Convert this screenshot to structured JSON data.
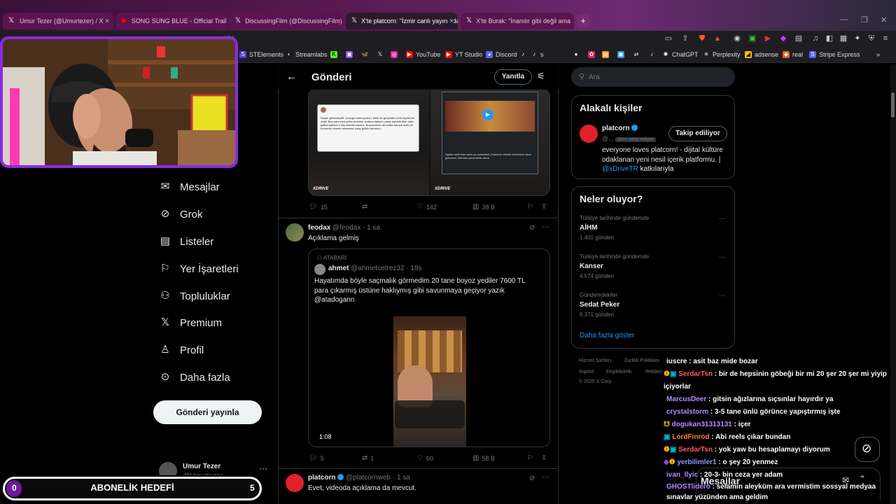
{
  "tabs": [
    {
      "icon": "x-logo",
      "label": "Umur Tezer (@Umurtezer) / X"
    },
    {
      "icon": "youtube-logo",
      "label": "SONG SUNG BLUE - Official Trailer 2"
    },
    {
      "icon": "x-logo",
      "label": "DiscussingFilm (@DiscussingFilm) / X"
    },
    {
      "icon": "x-logo",
      "label": "X'te platcorn: \"İzmir canlı yayınında"
    },
    {
      "icon": "x-logo",
      "label": "X'te Burak: \"İnanılır gibi değil ama"
    }
  ],
  "address_fragment": "954",
  "bookmarks": [
    "STElements",
    "Streamlabs",
    "YouTube",
    "YT Studio",
    "Discord",
    "s",
    "ChatGPT",
    "Perplexity",
    "adsense",
    "real",
    "Stripe Express"
  ],
  "sidebar": {
    "items": [
      {
        "label": "Mesajlar",
        "icon": "mail-icon"
      },
      {
        "label": "Grok",
        "icon": "grok-icon"
      },
      {
        "label": "Listeler",
        "icon": "list-icon"
      },
      {
        "label": "Yer İşaretleri",
        "icon": "bookmark-icon"
      },
      {
        "label": "Topluluklar",
        "icon": "communities-icon"
      },
      {
        "label": "Premium",
        "icon": "x-logo-icon"
      },
      {
        "label": "Profil",
        "icon": "profile-icon"
      },
      {
        "label": "Daha fazla",
        "icon": "more-circle-icon"
      }
    ],
    "post_button": "Gönderi yayınla",
    "user_name": "Umur Tezer",
    "user_handle": "@Umurtezer"
  },
  "sub_goal": {
    "left": "0",
    "label": "ABONELİK HEDEFİ",
    "right": "5",
    "progress": 0
  },
  "header": {
    "title": "Gönderi",
    "reply_button": "Yanıtla"
  },
  "top_tweet": {
    "img1_text": "Keşke gitmeseydik. Çocuğu tanımıyorum, belki de gerçekten kötü niyetli biri değil. Ben yanımıza gelen herkese sordum isteyen varsa yiyebilir diye ama galiba sadece 1 kişi istemiş boyoza. Boyozcunun da kafası karışık belki de. Kimsenin ekmek teknesine zarar gelsin istemem.",
    "img2_text": "Agalar ekliir edin salın şu mutabbeli. Kimsenin ekmek teknesine zarar gelmesin. Benden yana hellal olsun",
    "replies": "15",
    "likes": "142",
    "views": "38 B"
  },
  "tweet2": {
    "name": "feodax",
    "handle": "@feodax",
    "time": "1 sa",
    "text": "Açıklama gelmiş",
    "quote": {
      "context": "ATABARI",
      "name": "ahmet",
      "handle": "@ahmetcetrez32",
      "time": "18s",
      "text": "Hayatımda böyle saçmalık görmedim 20 tane boyoz yediler 7600 TL para çıkarmış üstüne haklıymış gibi savunmaya geçiyor yazık @atadogann",
      "video_duration": "1:08"
    },
    "replies": "5",
    "retweets": "1",
    "likes": "60",
    "views": "58 B"
  },
  "tweet3": {
    "name": "platcorn",
    "handle": "@platcornweb",
    "time": "1 sa",
    "text": "Evet, videoda açıklama da mevcut."
  },
  "right": {
    "search_placeholder": "Ara",
    "related_title": "Alakalı kişiler",
    "related": {
      "name": "platcorn",
      "handle": "@...",
      "follows_you": "Seni takip ediyor",
      "follow_button": "Takip ediliyor",
      "bio_1": "everyone loves platcorn! - dijital kültüre odaklanan yeni nesil içerik platformu. |",
      "bio_link": "@xDriveTR",
      "bio_2": "katkılarıyla"
    },
    "trends_title": "Neler oluyor?",
    "trends": [
      {
        "meta": "Türkiye tarihinde gündemde",
        "name": "AİHM",
        "count": "1.401 gönderi"
      },
      {
        "meta": "Türkiye tarihinde gündemde",
        "name": "Kanser",
        "count": "4.574 gönderi"
      },
      {
        "meta": "Gündemdekiler",
        "name": "Sedat Peker",
        "count": "6.371 gönderi"
      }
    ],
    "show_more": "Daha fazla göster",
    "footer": [
      "Hizmet Şartları",
      "Gizlilik Politikası",
      "Imprint",
      "Erişilebilirlik",
      "Reklam",
      "© 2025 X Corp."
    ]
  },
  "chat": [
    {
      "user": "iuscre",
      "color": "#ffffff",
      "msg": ": asit baz mide bozar",
      "badges": ""
    },
    {
      "user": "SerdarTsn",
      "color": "#ff5a5a",
      "msg": ": bir de hepsinin göbeği bir mi 20 şer 20 şer mi yiyip içiyorlar",
      "badges": "1"
    },
    {
      "user": "MarcusDeer",
      "color": "#b28cff",
      "msg": ": gitsin ağızlarına sıçsınlar hayırdır ya",
      "badges": ""
    },
    {
      "user": "crystalstorm",
      "color": "#b28cff",
      "msg": ": 3-5 tane ünlü görünce yapıştırmış işte",
      "badges": ""
    },
    {
      "user": "dogukan31313131",
      "color": "#b28cff",
      "msg": ": içer",
      "badges": "w"
    },
    {
      "user": "LordFinrod",
      "color": "#ff7a3a",
      "msg": ": Abi reels çıkar bundan",
      "badges": "b"
    },
    {
      "user": "SerdarTsn",
      "color": "#ff5a5a",
      "msg": ": yok yaw bu hesaplamayı diyorum",
      "badges": "1"
    },
    {
      "user": "yerbilimler1",
      "color": "#8a9bff",
      "msg": ": o şey 20 yenmez",
      "badges": "p1"
    },
    {
      "user": "ivan_llyic",
      "color": "#b28cff",
      "msg": ": 20-3- bin ceza yer adam",
      "badges": ""
    },
    {
      "user": "GHOSTlidero",
      "color": "#b28cff",
      "msg": ": selamın aleyküm ara vermistim sossyal medyaa sınavlar yüzünden ama geldim",
      "badges": ""
    }
  ],
  "dm_bar": {
    "label": "Mesajlar"
  }
}
